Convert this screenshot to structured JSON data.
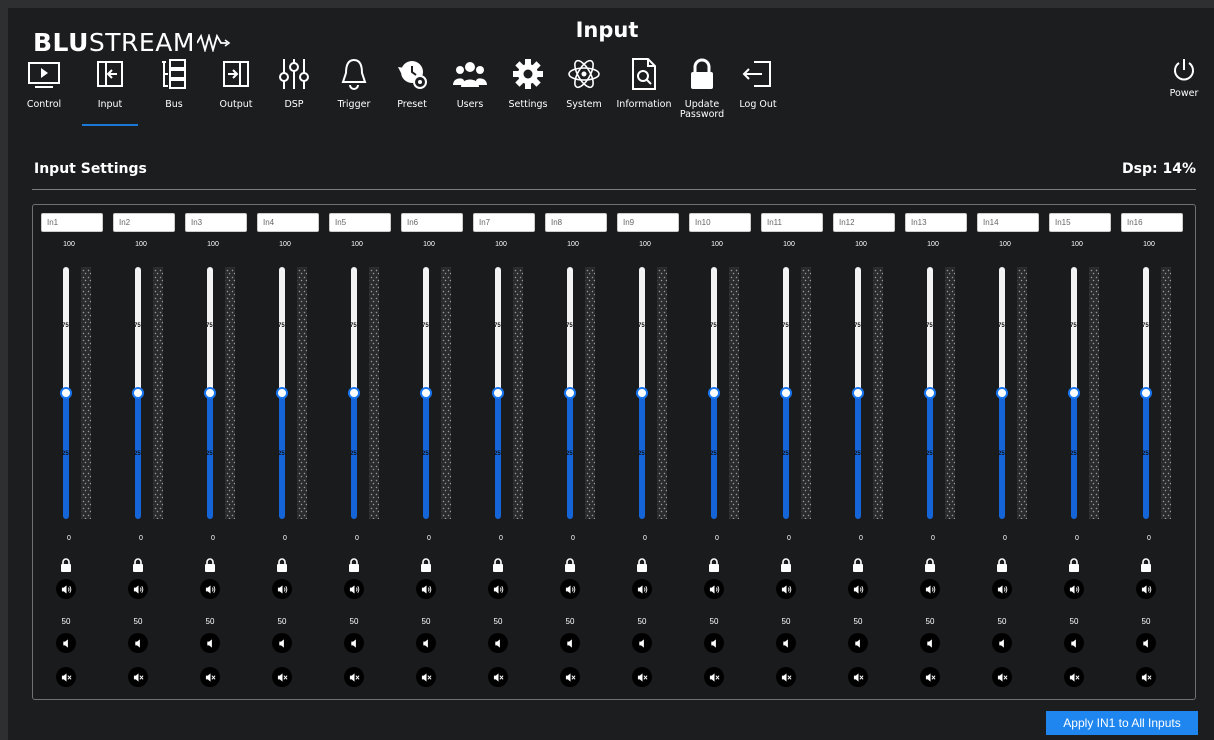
{
  "brand": {
    "bold": "BLU",
    "thin": "STREAM"
  },
  "page_title": "Input",
  "nav": [
    {
      "label": "Control",
      "icon": "play-monitor-icon"
    },
    {
      "label": "Input",
      "icon": "input-arrow-icon",
      "active": true
    },
    {
      "label": "Bus",
      "icon": "bus-icon"
    },
    {
      "label": "Output",
      "icon": "output-arrow-icon"
    },
    {
      "label": "DSP",
      "icon": "dsp-sliders-icon"
    },
    {
      "label": "Trigger",
      "icon": "bell-icon"
    },
    {
      "label": "Preset",
      "icon": "preset-history-icon"
    },
    {
      "label": "Users",
      "icon": "users-icon"
    },
    {
      "label": "Settings",
      "icon": "gear-icon"
    },
    {
      "label": "System",
      "icon": "atom-icon"
    },
    {
      "label": "Information",
      "icon": "document-search-icon"
    },
    {
      "label": "Update\nPassword",
      "icon": "lock-icon"
    },
    {
      "label": "Log Out",
      "icon": "logout-icon"
    }
  ],
  "power_label": "Power",
  "section_title": "Input Settings",
  "dsp": "Dsp: 14%",
  "channels": [
    {
      "name": "In1",
      "level": 50
    },
    {
      "name": "In2",
      "level": 50
    },
    {
      "name": "In3",
      "level": 50
    },
    {
      "name": "In4",
      "level": 50
    },
    {
      "name": "In5",
      "level": 50
    },
    {
      "name": "In6",
      "level": 50
    },
    {
      "name": "In7",
      "level": 50
    },
    {
      "name": "In8",
      "level": 50
    },
    {
      "name": "In9",
      "level": 50
    },
    {
      "name": "In10",
      "level": 50
    },
    {
      "name": "In11",
      "level": 50
    },
    {
      "name": "In12",
      "level": 50
    },
    {
      "name": "In13",
      "level": 50
    },
    {
      "name": "In14",
      "level": 50
    },
    {
      "name": "In15",
      "level": 50
    },
    {
      "name": "In16",
      "level": 50
    }
  ],
  "scale": {
    "top": "100",
    "bottom": "0",
    "t75": "75",
    "t25": "25"
  },
  "volume_label": "50",
  "apply_label": "Apply IN1 to All Inputs",
  "colors": {
    "accent": "#1f86f0",
    "track_blue": "#1565d8",
    "background": "#1c1d1f"
  }
}
